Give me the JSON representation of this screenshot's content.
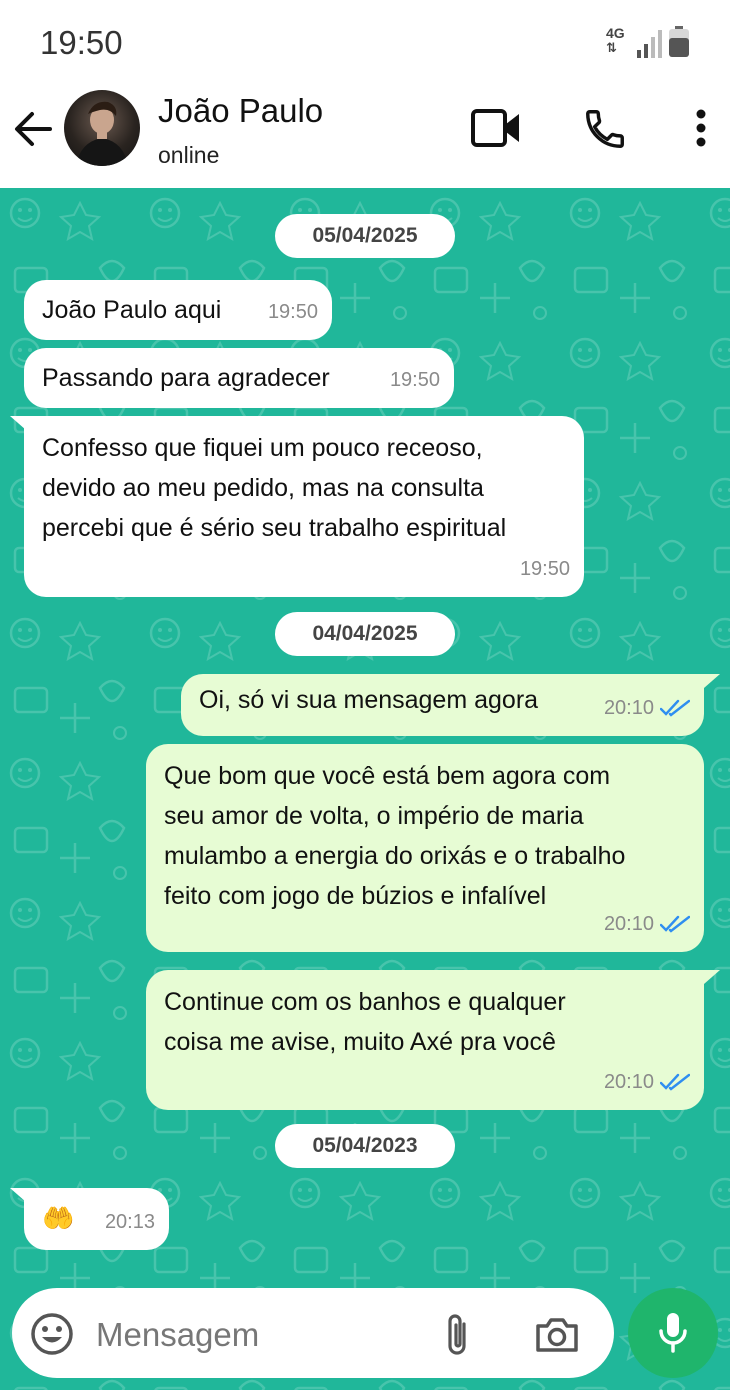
{
  "status_bar": {
    "time": "19:50",
    "network": "4G"
  },
  "header": {
    "contact_name": "João Paulo",
    "contact_status": "online"
  },
  "messages": [
    {
      "type": "date",
      "text": "05/04/2025"
    },
    {
      "type": "in",
      "text": "João Paulo aqui",
      "time": "19:50"
    },
    {
      "type": "in",
      "text": "Passando para agradecer",
      "time": "19:50"
    },
    {
      "type": "in",
      "text_lines": [
        "Confesso que fiquei um pouco receoso,",
        "devido ao meu pedido, mas na consulta",
        "percebi que é sério seu trabalho espiritual"
      ],
      "time": "19:50"
    },
    {
      "type": "date",
      "text": "04/04/2025"
    },
    {
      "type": "out",
      "text": "Oi, só vi sua mensagem agora",
      "time": "20:10",
      "read": true
    },
    {
      "type": "out",
      "text_lines": [
        "Que bom que você está bem agora com",
        "seu amor de volta, o império de maria",
        "mulambo a energia do orixás e o trabalho",
        "feito com jogo de búzios e infalível"
      ],
      "time": "20:10",
      "read": true
    },
    {
      "type": "out",
      "text_lines": [
        "Continue com os banhos e qualquer",
        "coisa me avise, muito Axé pra você"
      ],
      "time": "20:10",
      "read": true
    },
    {
      "type": "date",
      "text": "05/04/2023"
    },
    {
      "type": "in",
      "text": "🤲",
      "time": "20:13"
    }
  ],
  "input": {
    "placeholder": "Mensagem"
  },
  "colors": {
    "chat_background": "#20b79a",
    "outgoing_bubble": "#e7fcd4",
    "incoming_bubble": "#ffffff",
    "read_ticks": "#2f8ef0",
    "mic_button": "#1fb56c"
  },
  "icons": [
    "back-arrow-icon",
    "video-call-icon",
    "phone-icon",
    "more-vert-icon",
    "emoji-icon",
    "attach-icon",
    "camera-icon",
    "mic-icon"
  ]
}
